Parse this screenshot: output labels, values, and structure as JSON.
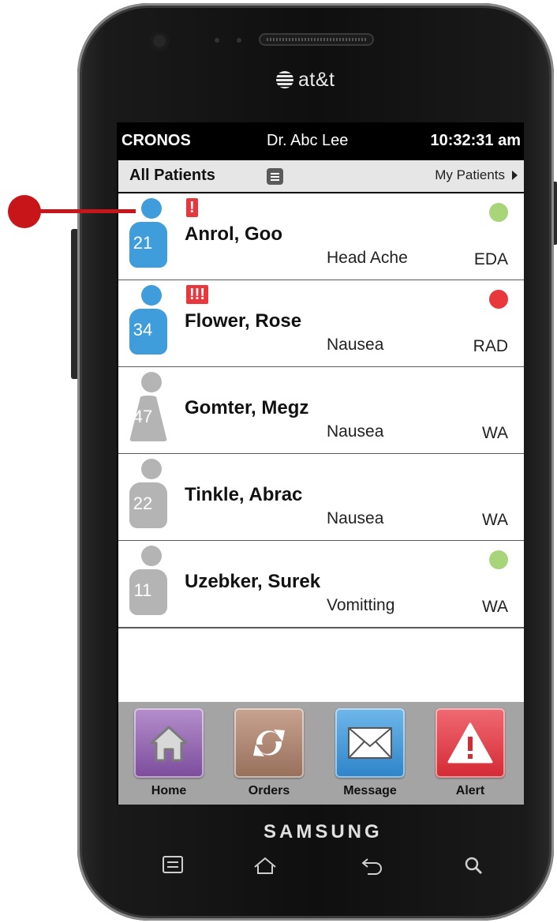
{
  "device": {
    "carrier": "at&t",
    "brand": "SAMSUNG"
  },
  "status_bar": {
    "app_name": "CRONOS",
    "doctor": "Dr. Abc Lee",
    "time": "10:32:31 am"
  },
  "subheader": {
    "title": "All Patients",
    "filter_link": "My Patients"
  },
  "patients": [
    {
      "name": "Anrol, Goo",
      "number": "21",
      "complaint": "Head Ache",
      "dept": "EDA",
      "priority": "!",
      "avatar": "male",
      "avatar_color": "#3f9ddc",
      "status_dot": "#a8d47a"
    },
    {
      "name": "Flower, Rose",
      "number": "34",
      "complaint": "Nausea",
      "dept": "RAD",
      "priority": "!!!",
      "avatar": "male",
      "avatar_color": "#3f9ddc",
      "status_dot": "#e8383d"
    },
    {
      "name": "Gomter, Megz",
      "number": "47",
      "complaint": "Nausea",
      "dept": "WA",
      "priority": "",
      "avatar": "female",
      "avatar_color": "#b4b4b4",
      "status_dot": ""
    },
    {
      "name": "Tinkle, Abrac",
      "number": "22",
      "complaint": "Nausea",
      "dept": "WA",
      "priority": "",
      "avatar": "male",
      "avatar_color": "#b4b4b4",
      "status_dot": ""
    },
    {
      "name": "Uzebker, Surek",
      "number": "11",
      "complaint": "Vomitting",
      "dept": "WA",
      "priority": "",
      "avatar": "male",
      "avatar_color": "#b4b4b4",
      "status_dot": "#a8d47a"
    }
  ],
  "tabs": [
    {
      "label": "Home",
      "icon": "home-icon",
      "color": "#8a5aa8"
    },
    {
      "label": "Orders",
      "icon": "refresh-icon",
      "color": "#a97c66"
    },
    {
      "label": "Message",
      "icon": "envelope-icon",
      "color": "#3f96d6"
    },
    {
      "label": "Alert",
      "icon": "warning-icon",
      "color": "#e03540"
    }
  ]
}
